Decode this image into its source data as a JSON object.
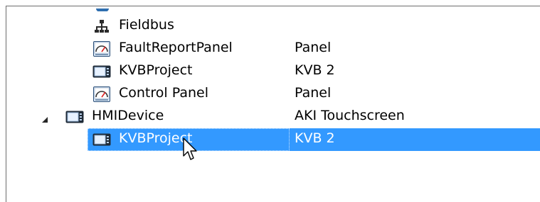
{
  "tree": {
    "rows": [
      {
        "name": "Fieldbus",
        "type": "",
        "icon": "network-icon"
      },
      {
        "name": "FaultReportPanel",
        "type": "Panel",
        "icon": "gauge-panel-icon"
      },
      {
        "name": "KVBProject",
        "type": "KVB 2",
        "icon": "screen-device-icon"
      },
      {
        "name": "Control Panel",
        "type": "Panel",
        "icon": "gauge-panel-icon"
      },
      {
        "name": "HMIDevice",
        "type": "AKI Touchscreen",
        "icon": "screen-device-icon",
        "expanded": true
      },
      {
        "name": "KVBProject",
        "type": "KVB 2",
        "icon": "screen-device-icon",
        "selected": true
      }
    ]
  },
  "colors": {
    "selection": "#3399ff",
    "selected_text": "#ffffff",
    "border": "#6d6d6d"
  }
}
